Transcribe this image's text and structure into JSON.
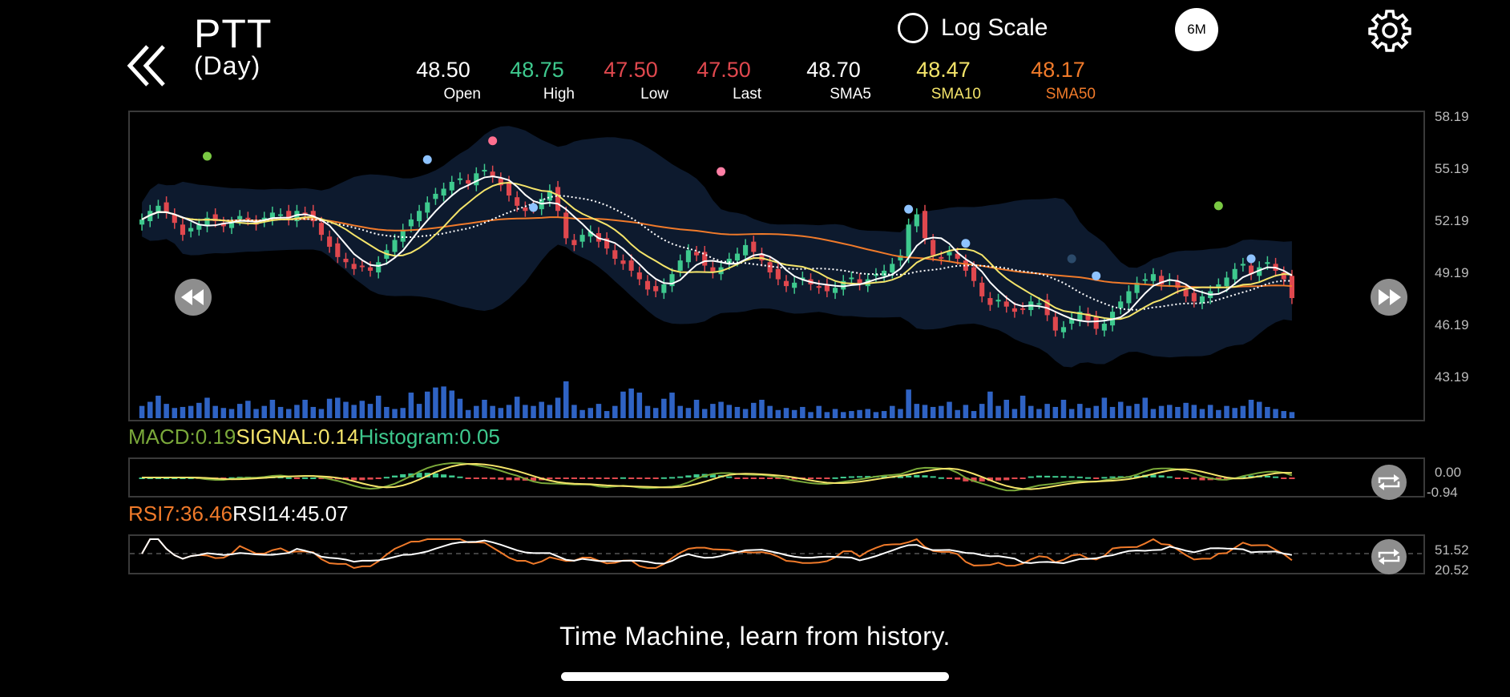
{
  "header": {
    "ticker": "PTT",
    "period": "(Day)",
    "log_scale_label": "Log Scale",
    "range_button": "6M"
  },
  "stats": [
    {
      "value": "48.50",
      "label": "Open",
      "color": "#ffffff",
      "label_color": "#ffffff"
    },
    {
      "value": "48.75",
      "label": "High",
      "color": "#3ec98e",
      "label_color": "#ffffff"
    },
    {
      "value": "47.50",
      "label": "Low",
      "color": "#e0484e",
      "label_color": "#ffffff"
    },
    {
      "value": "47.50",
      "label": "Last",
      "color": "#e0484e",
      "label_color": "#ffffff"
    },
    {
      "value": "48.70",
      "label": "SMA5",
      "color": "#ffffff",
      "label_color": "#ffffff"
    },
    {
      "value": "48.47",
      "label": "SMA10",
      "color": "#f4e46a",
      "label_color": "#f4e46a"
    },
    {
      "value": "48.17",
      "label": "SMA50",
      "color": "#f07a2a",
      "label_color": "#f07a2a"
    }
  ],
  "main_axis": [
    "58.19",
    "55.19",
    "52.19",
    "49.19",
    "46.19",
    "43.19"
  ],
  "macd": {
    "macd": "MACD:0.19",
    "signal": "SIGNAL:0.14",
    "histogram": "Histogram:0.05",
    "axis": [
      "0.00",
      "-0.94"
    ]
  },
  "rsi": {
    "rsi7": "RSI7:36.46",
    "rsi14": "RSI14:45.07",
    "axis": [
      "51.52",
      "20.52"
    ]
  },
  "footer": "Time Machine, learn from history.",
  "colors": {
    "up": "#3ec98e",
    "down": "#e0484e",
    "sma5": "#ffffff",
    "sma10": "#f4e46a",
    "sma50": "#f07a2a",
    "volume": "#2f63c4",
    "macd": "#7aa83a",
    "band": "#0d1a2e"
  },
  "chart_data": {
    "type": "candlestick",
    "ylim": [
      43.19,
      58.19
    ],
    "closes": [
      52.1,
      52.6,
      52.9,
      52.5,
      51.9,
      51.2,
      51.6,
      51.8,
      52.2,
      52.0,
      51.7,
      51.9,
      52.3,
      52.1,
      51.8,
      52.2,
      52.5,
      52.4,
      52.1,
      52.6,
      52.4,
      52.0,
      51.2,
      50.5,
      49.9,
      49.6,
      49.2,
      49.4,
      49.1,
      49.6,
      50.3,
      50.9,
      51.5,
      52.1,
      52.6,
      53.1,
      53.6,
      53.9,
      54.3,
      54.5,
      54.2,
      54.8,
      55.0,
      54.6,
      54.1,
      53.5,
      52.9,
      52.6,
      52.8,
      53.3,
      53.8,
      52.6,
      51.0,
      50.6,
      51.2,
      51.4,
      50.8,
      50.4,
      49.8,
      49.5,
      49.1,
      48.6,
      48.0,
      47.9,
      48.3,
      48.9,
      49.7,
      50.3,
      50.0,
      49.4,
      49.0,
      49.3,
      49.8,
      50.1,
      50.6,
      50.2,
      49.7,
      49.0,
      48.6,
      48.2,
      48.4,
      48.7,
      48.3,
      48.1,
      47.9,
      48.1,
      48.5,
      48.7,
      48.3,
      48.6,
      48.9,
      49.1,
      49.5,
      50.0,
      51.8,
      52.4,
      51.0,
      50.0,
      49.8,
      50.2,
      49.8,
      49.1,
      48.5,
      47.6,
      47.1,
      47.4,
      47.0,
      46.7,
      46.9,
      47.3,
      47.2,
      46.5,
      45.6,
      45.8,
      46.3,
      46.7,
      46.2,
      45.7,
      46.0,
      46.7,
      47.3,
      47.9,
      48.4,
      48.6,
      48.9,
      48.3,
      48.6,
      48.1,
      47.6,
      47.3,
      47.6,
      47.9,
      48.3,
      48.7,
      49.2,
      49.5,
      48.9,
      49.3,
      49.6,
      49.1,
      48.6,
      47.5
    ],
    "volumes": [
      12,
      16,
      22,
      14,
      10,
      11,
      12,
      15,
      20,
      12,
      10,
      9,
      14,
      17,
      9,
      12,
      18,
      11,
      9,
      13,
      18,
      11,
      9,
      19,
      20,
      16,
      13,
      17,
      14,
      22,
      11,
      9,
      10,
      25,
      14,
      26,
      30,
      31,
      27,
      19,
      8,
      12,
      18,
      12,
      10,
      13,
      21,
      13,
      12,
      16,
      13,
      20,
      36,
      13,
      8,
      10,
      14,
      7,
      12,
      26,
      29,
      25,
      12,
      10,
      19,
      25,
      12,
      10,
      18,
      9,
      14,
      16,
      13,
      11,
      9,
      15,
      18,
      12,
      8,
      10,
      8,
      11,
      6,
      12,
      6,
      9,
      6,
      7,
      8,
      9,
      6,
      7,
      12,
      9,
      28,
      14,
      13,
      11,
      12,
      16,
      8,
      13,
      7,
      14,
      26,
      12,
      18,
      9,
      22,
      12,
      9,
      14,
      11,
      18,
      9,
      14,
      10,
      12,
      20,
      11,
      16,
      12,
      14,
      20,
      9,
      12,
      13,
      11,
      15,
      13,
      9,
      13,
      8,
      12,
      10,
      12,
      18,
      16,
      11,
      9,
      7,
      6
    ],
    "rsi7_range": [
      20.52,
      51.52
    ],
    "macd_range": [
      -0.94,
      0.0
    ]
  }
}
